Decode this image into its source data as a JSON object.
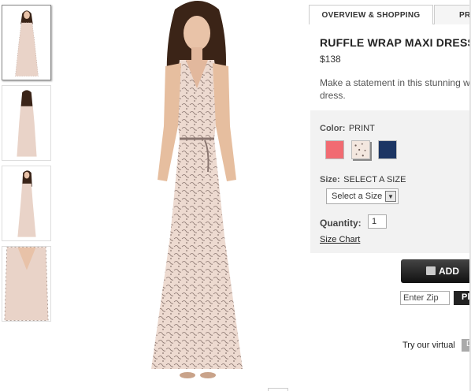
{
  "tabs": [
    {
      "label": "OVERVIEW & SHOPPING"
    },
    {
      "label": "PRO"
    }
  ],
  "product": {
    "title": "RUFFLE WRAP MAXI DRESS",
    "price": "$138",
    "description": "Make a statement in this stunning w dress."
  },
  "options": {
    "color_label": "Color:",
    "color_value": "PRINT",
    "swatches": [
      {
        "name": "coral",
        "color": "#f16b72"
      },
      {
        "name": "print",
        "color": "#f3e7df"
      },
      {
        "name": "navy",
        "color": "#1c3563"
      }
    ],
    "size_label": "Size:",
    "size_value": "SELECT A SIZE",
    "size_select": "Select a Size",
    "quantity_label": "Quantity:",
    "quantity_value": "1",
    "size_chart": "Size Chart"
  },
  "actions": {
    "add_label": "ADD",
    "zip_placeholder": "Enter Zip",
    "zip_button": "Pl",
    "virtual_label": "Try our virtual",
    "virtual_button": "D"
  }
}
